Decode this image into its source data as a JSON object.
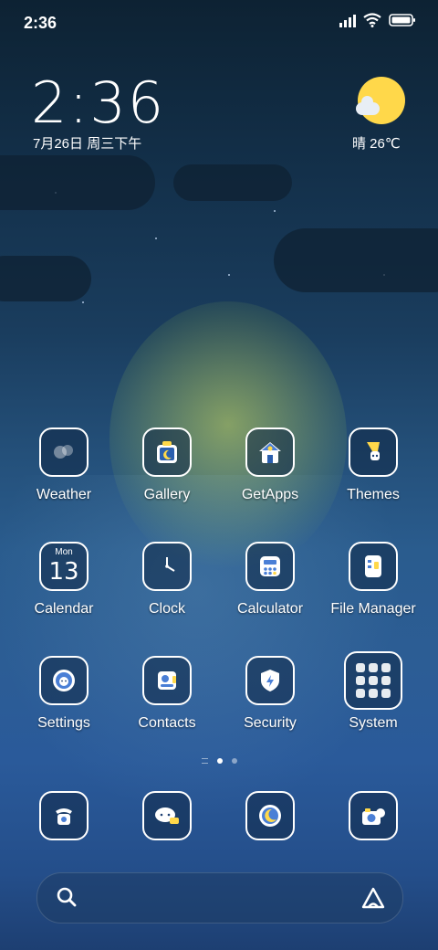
{
  "status": {
    "time": "2:36"
  },
  "lock_widget": {
    "time": "2:36",
    "date": "7月26日 周三下午"
  },
  "weather_widget": {
    "text": "晴 26℃",
    "icon": "sun-cloud-icon"
  },
  "apps": [
    {
      "label": "Weather",
      "icon": "weather-icon"
    },
    {
      "label": "Gallery",
      "icon": "gallery-icon"
    },
    {
      "label": "GetApps",
      "icon": "getapps-icon"
    },
    {
      "label": "Themes",
      "icon": "themes-icon"
    },
    {
      "label": "Calendar",
      "icon": "calendar-icon",
      "calendar_month": "Mon",
      "calendar_day": "13"
    },
    {
      "label": "Clock",
      "icon": "clock-icon"
    },
    {
      "label": "Calculator",
      "icon": "calculator-icon"
    },
    {
      "label": "File Manager",
      "icon": "file-manager-icon"
    },
    {
      "label": "Settings",
      "icon": "settings-icon"
    },
    {
      "label": "Contacts",
      "icon": "contacts-icon"
    },
    {
      "label": "Security",
      "icon": "security-icon"
    },
    {
      "label": "System",
      "icon": "system-folder-icon"
    }
  ],
  "dock": [
    {
      "icon": "phone-icon"
    },
    {
      "icon": "messages-icon"
    },
    {
      "icon": "browser-icon"
    },
    {
      "icon": "camera-icon"
    }
  ],
  "page_indicator": {
    "pages": 2,
    "current": 1
  },
  "colors": {
    "moon": "#d7e65a",
    "sun": "#ffd84a",
    "sky_top": "#0d2233",
    "sky_bottom": "#1d3f72"
  }
}
